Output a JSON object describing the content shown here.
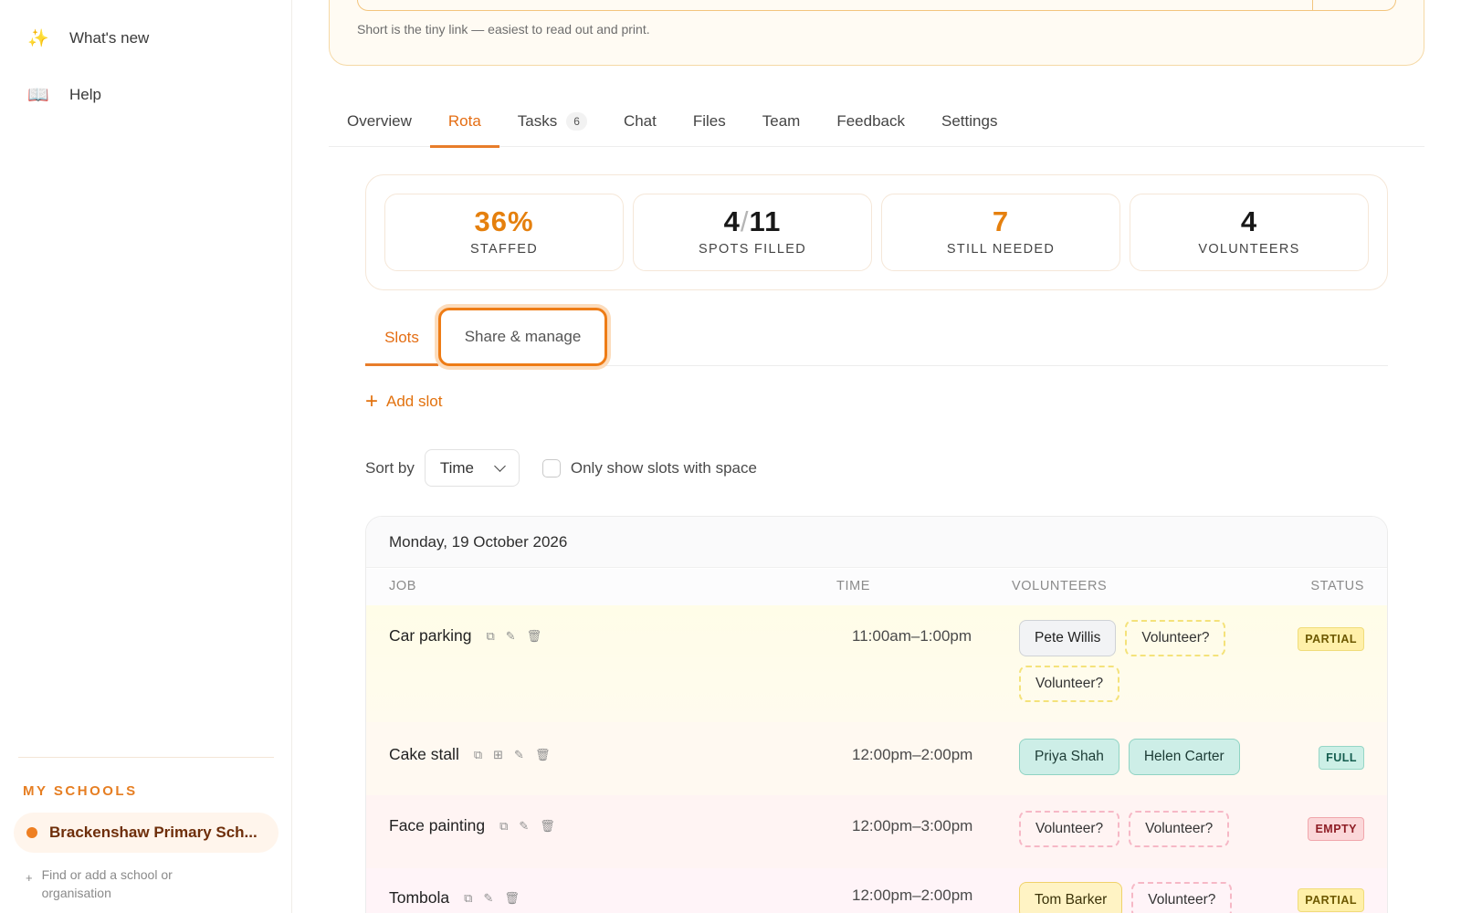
{
  "sidebar": {
    "items": [
      {
        "icon": "sparkles-icon",
        "glyph": "✨",
        "label": "What's new"
      },
      {
        "icon": "book-icon",
        "glyph": "📖",
        "label": "Help"
      }
    ],
    "section_title": "MY SCHOOLS",
    "active_school": "Brackenshaw Primary Sch...",
    "find_school": "Find or add a school or organisation"
  },
  "top_card": {
    "hint": "Short is the tiny link — easiest to read out and print."
  },
  "tabs": [
    {
      "label": "Overview"
    },
    {
      "label": "Rota",
      "active": true
    },
    {
      "label": "Tasks",
      "count": "6"
    },
    {
      "label": "Chat"
    },
    {
      "label": "Files"
    },
    {
      "label": "Team"
    },
    {
      "label": "Feedback"
    },
    {
      "label": "Settings"
    }
  ],
  "stats": {
    "staffed": {
      "value": "36%",
      "label": "STAFFED"
    },
    "spots": {
      "filled": "4",
      "sep": "/",
      "total": "11",
      "label": "SPOTS FILLED"
    },
    "needed": {
      "value": "7",
      "label": "STILL NEEDED"
    },
    "volunteers": {
      "value": "4",
      "label": "VOLUNTEERS"
    }
  },
  "subtabs": {
    "slots": "Slots",
    "share": "Share & manage"
  },
  "add_slot": "Add slot",
  "sort": {
    "label": "Sort by",
    "value": "Time",
    "filter_label": "Only show slots with space"
  },
  "table": {
    "date": "Monday, 19 October 2026",
    "headers": {
      "job": "JOB",
      "time": "TIME",
      "volunteers": "VOLUNTEERS",
      "status": "STATUS"
    },
    "rows": [
      {
        "job": "Car parking",
        "time": "11:00am–1:00pm",
        "status": "PARTIAL",
        "volunteers": [
          "Pete Willis",
          "Volunteer?",
          "Volunteer?"
        ]
      },
      {
        "job": "Cake stall",
        "time": "12:00pm–2:00pm",
        "status": "FULL",
        "volunteers": [
          "Priya Shah",
          "Helen Carter"
        ]
      },
      {
        "job": "Face painting",
        "time": "12:00pm–3:00pm",
        "status": "EMPTY",
        "volunteers": [
          "Volunteer?",
          "Volunteer?"
        ]
      },
      {
        "job": "Tombola",
        "time": "12:00pm–2:00pm",
        "status": "PARTIAL",
        "volunteers": [
          "Tom Barker",
          "Volunteer?"
        ]
      }
    ]
  }
}
